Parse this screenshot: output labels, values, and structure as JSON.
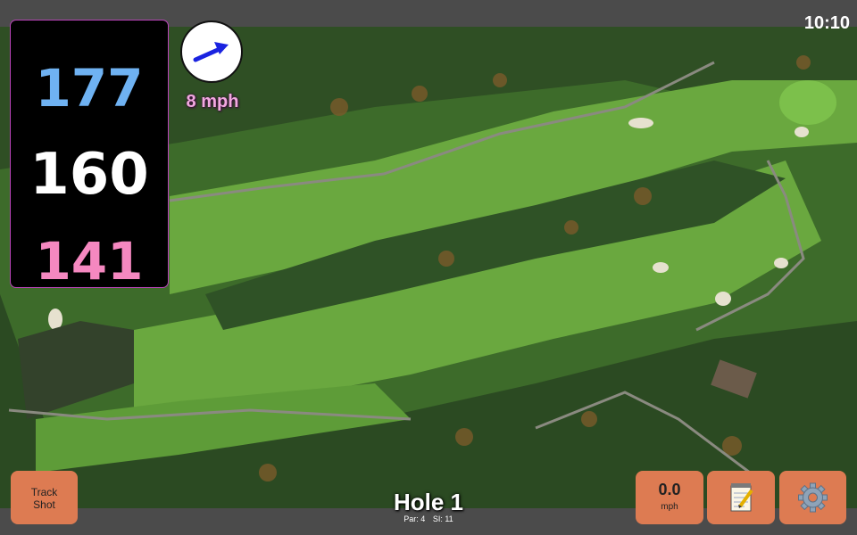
{
  "status": {
    "time": "10:10"
  },
  "distances": {
    "back": "177",
    "middle": "160",
    "front": "141"
  },
  "wind": {
    "speed_label": "8 mph",
    "direction_icon": "wind-arrow-icon",
    "arrow_color": "#1a23e0"
  },
  "hole": {
    "title": "Hole 1",
    "par": "Par: 4",
    "si": "SI: 11"
  },
  "buttons": {
    "track_shot_line1": "Track",
    "track_shot_line2": "Shot",
    "wind_value": "0.0",
    "wind_unit": "mph",
    "notes_icon": "notepad-icon",
    "settings_icon": "gear-icon"
  },
  "colors": {
    "back": "#6fb2f2",
    "middle": "#ffffff",
    "front": "#f588c0",
    "button": "#dd7b52"
  }
}
